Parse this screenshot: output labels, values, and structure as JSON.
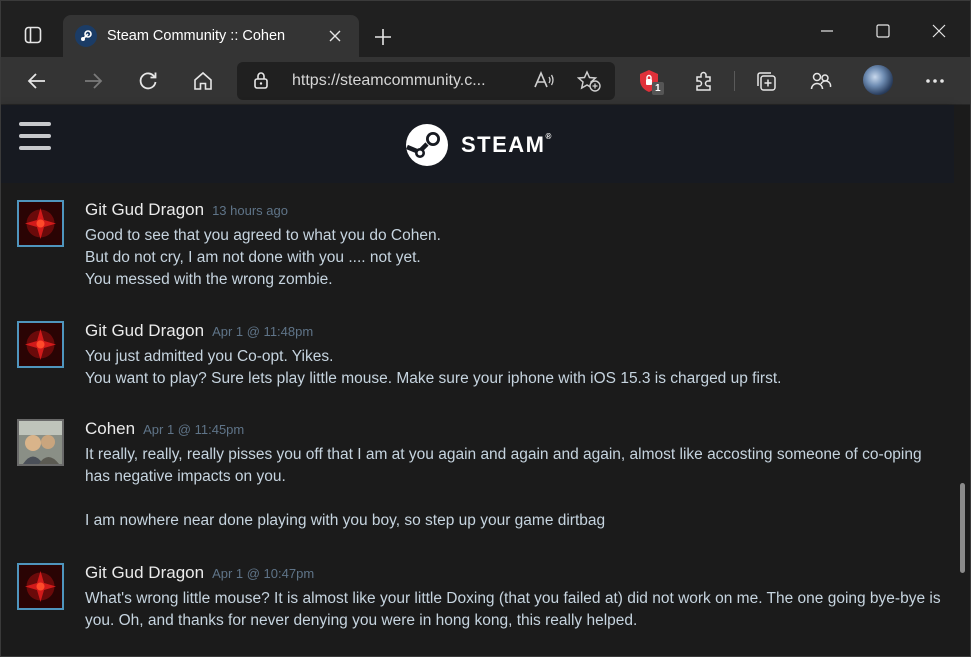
{
  "browser": {
    "tab_title": "Steam Community :: Cohen",
    "url": "https://steamcommunity.c...",
    "extension_badge": "1",
    "icons": {
      "tab_actions": "tab-actions-icon",
      "new_tab": "plus-icon",
      "minimize": "minimize-icon",
      "maximize": "maximize-icon",
      "close": "close-icon",
      "back": "back-arrow-icon",
      "forward": "forward-arrow-icon",
      "refresh": "refresh-icon",
      "home": "home-icon",
      "lock": "lock-icon",
      "read_aloud": "read-aloud-icon",
      "add_favorite": "star-plus-icon",
      "extension": "shield-extension-icon",
      "extensions": "puzzle-icon",
      "collections": "collections-icon",
      "favorites": "favorites-icon",
      "menu": "more-icon"
    }
  },
  "steam": {
    "logo_text": "STEAM",
    "logo_reg": "®"
  },
  "comments": [
    {
      "author": "Git Gud Dragon",
      "timestamp": "13 hours ago",
      "lines": [
        "Good to see that you agreed to what you do Cohen.",
        "But do not cry, I am not done with you .... not yet.",
        "You messed with the wrong zombie."
      ]
    },
    {
      "author": "Git Gud Dragon",
      "timestamp": "Apr 1 @ 11:48pm",
      "lines": [
        "You just admitted you Co-opt. Yikes.",
        "You want to play? Sure lets play little mouse. Make sure your iphone with iOS 15.3 is charged up first."
      ]
    },
    {
      "author": "Cohen",
      "timestamp": "Apr 1 @ 11:45pm",
      "lines": [
        "It really, really, really pisses you off that I am at you again and again and again, almost like accosting someone of co-oping has negative impacts on you.",
        "",
        "I am nowhere near done playing with you boy, so step up your game dirtbag"
      ]
    },
    {
      "author": "Git Gud Dragon",
      "timestamp": "Apr 1 @ 10:47pm",
      "lines": [
        "What's wrong little mouse? It is almost like your little Doxing (that you failed at) did not work on me. The one going bye-bye is you. Oh, and thanks for never denying you were in hong kong, this really helped."
      ]
    }
  ],
  "colors": {
    "steam_header": "#171a21",
    "author_text": "#ebebeb",
    "timestamp_text": "#5f7488",
    "body_text": "#c6d4df",
    "online_border": "#4f95bd"
  }
}
